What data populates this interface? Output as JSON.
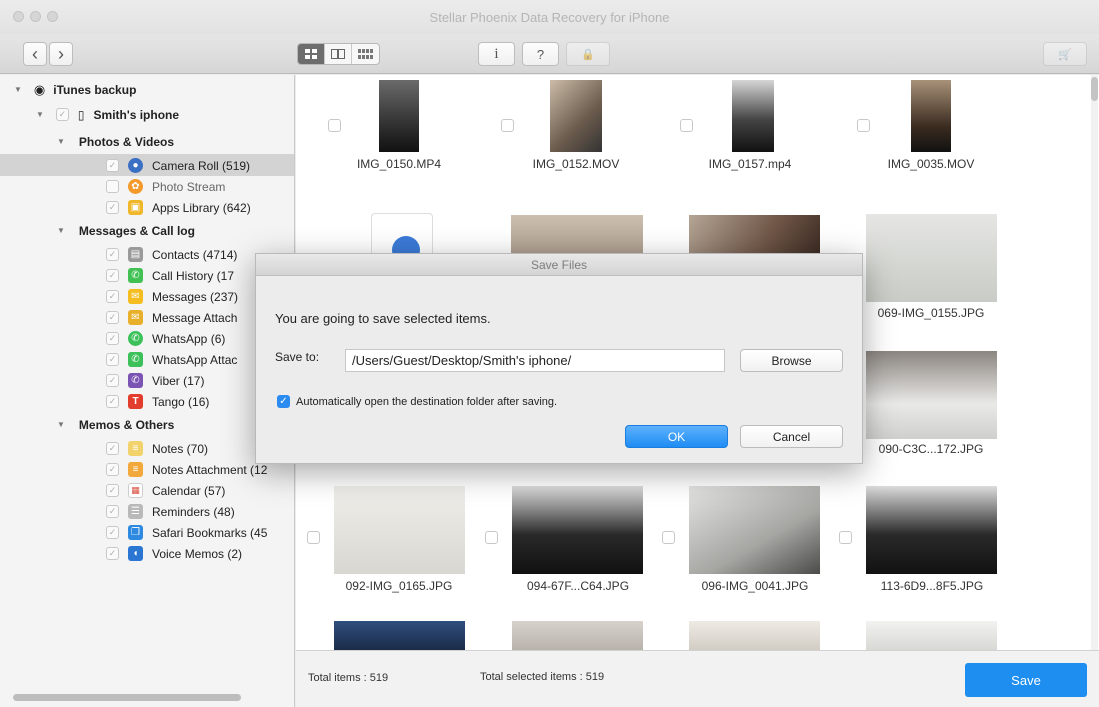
{
  "window": {
    "title": "Stellar Phoenix Data Recovery for iPhone"
  },
  "toolbar": {
    "back": "‹",
    "forward": "›",
    "info": "i",
    "help": "?",
    "lock": "🔒",
    "cart": "🛒"
  },
  "sidebar": {
    "root": "iTunes backup",
    "device": "Smith's iphone",
    "groups": [
      {
        "label": "Photos & Videos",
        "items": [
          {
            "label": "Camera Roll (519)",
            "icon_color": "#3b6fc4"
          },
          {
            "label": "Photo Stream",
            "icon_color": "#f39a2b"
          },
          {
            "label": "Apps Library (642)",
            "icon_color": "#f0b72a"
          }
        ]
      },
      {
        "label": "Messages & Call log",
        "items": [
          {
            "label": "Contacts (4714)",
            "icon_color": "#9a9a9a"
          },
          {
            "label": "Call History (17",
            "icon_color": "#41c154"
          },
          {
            "label": "Messages (237)",
            "icon_color": "#f5bd1f"
          },
          {
            "label": "Message Attach",
            "icon_color": "#e8b02a"
          },
          {
            "label": "WhatsApp (6)",
            "icon_color": "#3cc15a"
          },
          {
            "label": "WhatsApp Attac",
            "icon_color": "#3cc15a"
          },
          {
            "label": "Viber (17)",
            "icon_color": "#7b53b3"
          },
          {
            "label": "Tango (16)",
            "icon_color": "#e23d2c"
          }
        ]
      },
      {
        "label": "Memos & Others",
        "items": [
          {
            "label": "Notes (70)",
            "icon_color": "#f2d36b"
          },
          {
            "label": "Notes Attachment (12",
            "icon_color": "#f2a83b"
          },
          {
            "label": "Calendar (57)",
            "icon_color": "#d94a3c"
          },
          {
            "label": "Reminders (48)",
            "icon_color": "#b9b9b9"
          },
          {
            "label": "Safari Bookmarks (45",
            "icon_color": "#2d8ae0"
          },
          {
            "label": "Voice Memos (2)",
            "icon_color": "#2a76d2"
          }
        ]
      }
    ]
  },
  "thumbnails": {
    "row1": [
      "IMG_0150.MP4",
      "IMG_0152.MOV",
      "IMG_0157.mp4",
      "IMG_0035.MOV"
    ],
    "right_col": [
      "069-IMG_0155.JPG",
      "090-C3C...172.JPG"
    ],
    "row4": [
      "092-IMG_0165.JPG",
      "094-67F...C64.JPG",
      "096-IMG_0041.JPG",
      "113-6D9...8F5.JPG"
    ]
  },
  "footer": {
    "total_items": "Total items : 519",
    "total_selected": "Total selected items : 519",
    "save_label": "Save"
  },
  "dialog": {
    "title": "Save Files",
    "message": "You are going to save selected items.",
    "save_to_label": "Save to:",
    "path": "/Users/Guest/Desktop/Smith's iphone/",
    "browse_label": "Browse",
    "auto_open_label": "Automatically open the destination folder after saving.",
    "ok_label": "OK",
    "cancel_label": "Cancel"
  }
}
